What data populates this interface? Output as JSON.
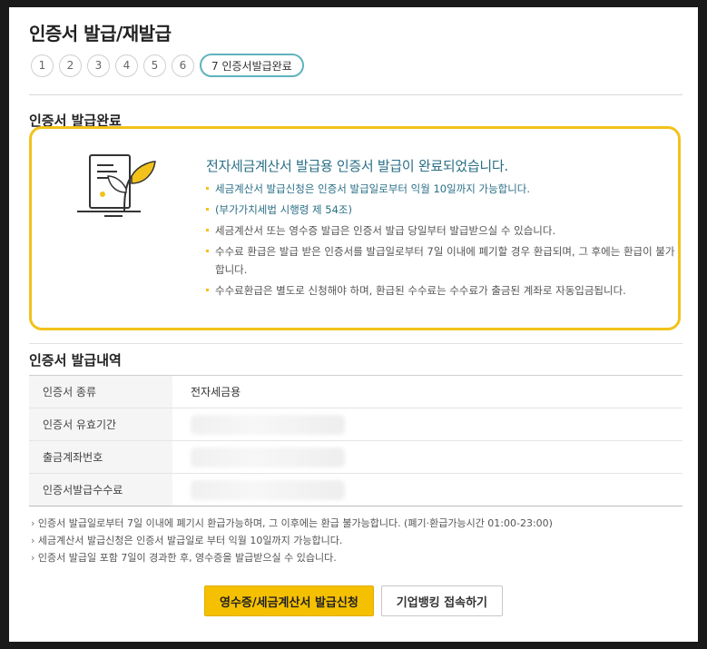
{
  "page": {
    "title": "인증서 발급/재발급"
  },
  "steps": [
    "1",
    "2",
    "3",
    "4",
    "5",
    "6",
    "7 인증서발급완료"
  ],
  "complete_section": {
    "title": "인증서 발급완료",
    "headline": "전자세금계산서 발급용 인증서 발급이 완료되었습니다.",
    "notes": [
      "세금계산서 발급신청은 인증서 발급일로부터 익월 10일까지 가능합니다.",
      "(부가가치세법 시행령 제 54조)",
      "세금계산서 또는 영수증 발급은 인증서 발급 당일부터 발급받으실 수 있습니다.",
      "수수료 환급은 발급 받은 인증서를 발급일로부터 7일 이내에 폐기할 경우 환급되며, 그 후에는 환급이 불가합니다.",
      "수수료환급은 별도로 신청해야 하며, 환급된 수수료는 수수료가 출금된 계좌로 자동입금됩니다."
    ]
  },
  "history_section": {
    "title": "인증서 발급내역",
    "rows": [
      {
        "label": "인증서 종류",
        "value": "전자세금용"
      },
      {
        "label": "인증서 유효기간",
        "value": ""
      },
      {
        "label": "출금계좌번호",
        "value": ""
      },
      {
        "label": "인증서발급수수료",
        "value": ""
      }
    ]
  },
  "footnotes": [
    "인증서 발급일로부터 7일 이내에 폐기시 환급가능하며, 그 이후에는 환급 불가능합니다. (폐기·환급가능시간 01:00-23:00)",
    "세금계산서 발급신청은 인증서 발급일로 부터 익월 10일까지 가능합니다.",
    "인증서 발급일 포함 7일이 경과한 후, 영수증을 발급받으실 수 있습니다."
  ],
  "buttons": {
    "primary": "영수증/세금계산서 발급신청",
    "secondary": "기업뱅킹 접속하기"
  },
  "colors": {
    "accent": "#f2c21b",
    "headline": "#2a6f86",
    "active_step": "#5fb3bd"
  }
}
